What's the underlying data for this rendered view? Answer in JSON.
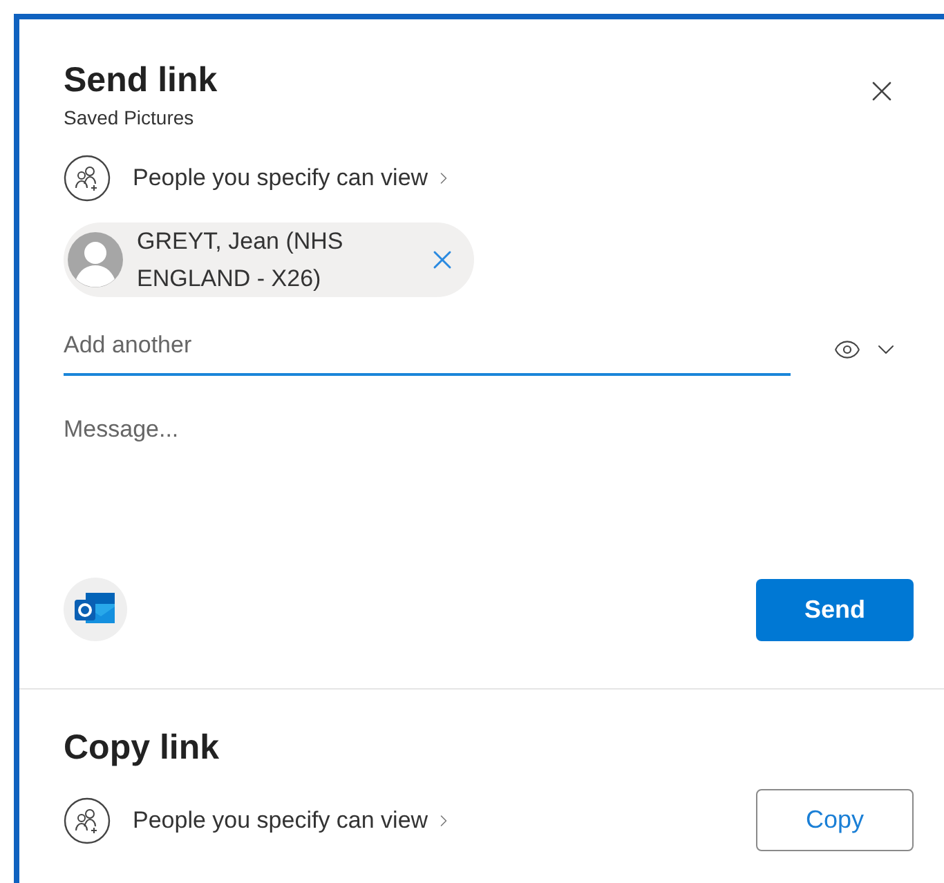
{
  "send_link": {
    "title": "Send link",
    "subtitle": "Saved Pictures",
    "permission": "People you specify can view",
    "recipients": [
      {
        "name": "GREYT, Jean (NHS ENGLAND - X26)"
      }
    ],
    "add_field": {
      "placeholder": "Add another"
    },
    "message": {
      "placeholder": "Message..."
    },
    "send_button": "Send"
  },
  "copy_link": {
    "title": "Copy link",
    "permission": "People you specify can view",
    "copy_button": "Copy"
  }
}
